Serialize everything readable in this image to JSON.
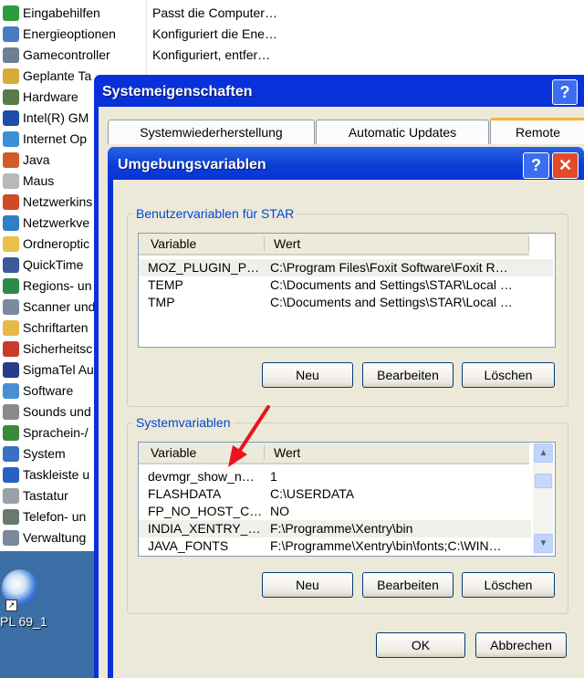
{
  "control_panel": {
    "items": [
      {
        "name": "Eingabehilfen",
        "desc": "Passt die Computer…",
        "icon": "accessibility-icon",
        "color": "#2c9c3c"
      },
      {
        "name": "Energieoptionen",
        "desc": "Konfiguriert die Ene…",
        "icon": "power-options-icon",
        "color": "#4a7cc4"
      },
      {
        "name": "Gamecontroller",
        "desc": "Konfiguriert, entfer…",
        "icon": "game-controller-icon",
        "color": "#6e7f93"
      },
      {
        "name": "Geplante Ta",
        "desc": "",
        "icon": "scheduled-tasks-icon",
        "color": "#d9a93a"
      },
      {
        "name": "Hardware",
        "desc": "",
        "icon": "hardware-icon",
        "color": "#5a7a4a"
      },
      {
        "name": "Intel(R) GM",
        "desc": "",
        "icon": "intel-graphics-icon",
        "color": "#1d4fa8"
      },
      {
        "name": "Internet Op",
        "desc": "",
        "icon": "internet-options-icon",
        "color": "#3b8fd6"
      },
      {
        "name": "Java",
        "desc": "",
        "icon": "java-icon",
        "color": "#d25b2a"
      },
      {
        "name": "Maus",
        "desc": "",
        "icon": "mouse-icon",
        "color": "#b8b8b8"
      },
      {
        "name": "Netzwerkins",
        "desc": "",
        "icon": "network-setup-icon",
        "color": "#d04a2a"
      },
      {
        "name": "Netzwerkve",
        "desc": "",
        "icon": "network-connections-icon",
        "color": "#2f80c8"
      },
      {
        "name": "Ordneroptic",
        "desc": "",
        "icon": "folder-options-icon",
        "color": "#e8c04a"
      },
      {
        "name": "QuickTime",
        "desc": "",
        "icon": "quicktime-icon",
        "color": "#3a5a9a"
      },
      {
        "name": "Regions- un",
        "desc": "",
        "icon": "regional-settings-icon",
        "color": "#2e8a4a"
      },
      {
        "name": "Scanner und",
        "desc": "",
        "icon": "scanner-icon",
        "color": "#7a8aa0"
      },
      {
        "name": "Schriftarten",
        "desc": "",
        "icon": "fonts-icon",
        "color": "#e8b84a"
      },
      {
        "name": "Sicherheitsc",
        "desc": "",
        "icon": "security-center-icon",
        "color": "#c83a2a"
      },
      {
        "name": "SigmaTel Au",
        "desc": "",
        "icon": "sigmatel-audio-icon",
        "color": "#2a3a8a"
      },
      {
        "name": "Software",
        "desc": "",
        "icon": "software-icon",
        "color": "#4a90d0"
      },
      {
        "name": "Sounds und",
        "desc": "",
        "icon": "sounds-icon",
        "color": "#8a8a8a"
      },
      {
        "name": "Sprachein-/",
        "desc": "",
        "icon": "speech-icon",
        "color": "#3a8a3a"
      },
      {
        "name": "System",
        "desc": "",
        "icon": "system-icon",
        "color": "#3a70c0"
      },
      {
        "name": "Taskleiste u",
        "desc": "",
        "icon": "taskbar-icon",
        "color": "#2a60c0"
      },
      {
        "name": "Tastatur",
        "desc": "",
        "icon": "keyboard-icon",
        "color": "#9aa0aa"
      },
      {
        "name": "Telefon- un",
        "desc": "",
        "icon": "phone-modem-icon",
        "color": "#6a7a6a"
      },
      {
        "name": "Verwaltung",
        "desc": "",
        "icon": "administrative-tools-icon",
        "color": "#7a8a9a"
      }
    ]
  },
  "desktop": {
    "icon_label": "PL 69_1"
  },
  "system_properties": {
    "title": "Systemeigenschaften",
    "help_glyph": "?",
    "tabs": [
      "Systemwiederherstellung",
      "Automatic Updates",
      "Remote"
    ]
  },
  "env_dialog": {
    "title": "Umgebungsvariablen",
    "help_glyph": "?",
    "close_glyph": "✕",
    "user_group_label": "Benutzervariablen für STAR",
    "system_group_label": "Systemvariablen",
    "col_variable": "Variable",
    "col_value": "Wert",
    "user_vars": [
      {
        "variable": "MOZ_PLUGIN_P…",
        "value": "C:\\Program Files\\Foxit Software\\Foxit R…"
      },
      {
        "variable": "TEMP",
        "value": "C:\\Documents and Settings\\STAR\\Local …"
      },
      {
        "variable": "TMP",
        "value": "C:\\Documents and Settings\\STAR\\Local …"
      }
    ],
    "system_vars": [
      {
        "variable": "devmgr_show_n…",
        "value": "1"
      },
      {
        "variable": "FLASHDATA",
        "value": "C:\\USERDATA"
      },
      {
        "variable": "FP_NO_HOST_C…",
        "value": "NO"
      },
      {
        "variable": "INDIA_XENTRY_…",
        "value": "F:\\Programme\\Xentry\\bin"
      },
      {
        "variable": "JAVA_FONTS",
        "value": "F:\\Programme\\Xentry\\bin\\fonts;C:\\WIN…"
      }
    ],
    "btn_new": "Neu",
    "btn_edit": "Bearbeiten",
    "btn_delete": "Löschen",
    "btn_ok": "OK",
    "btn_cancel": "Abbrechen",
    "scroll_up_glyph": "▲",
    "scroll_down_glyph": "▼"
  },
  "colors": {
    "title_bar": "#0831d9",
    "group_label": "#0046d5",
    "annotation_arrow": "#e8141e",
    "desktop": "#3a6ea5"
  }
}
